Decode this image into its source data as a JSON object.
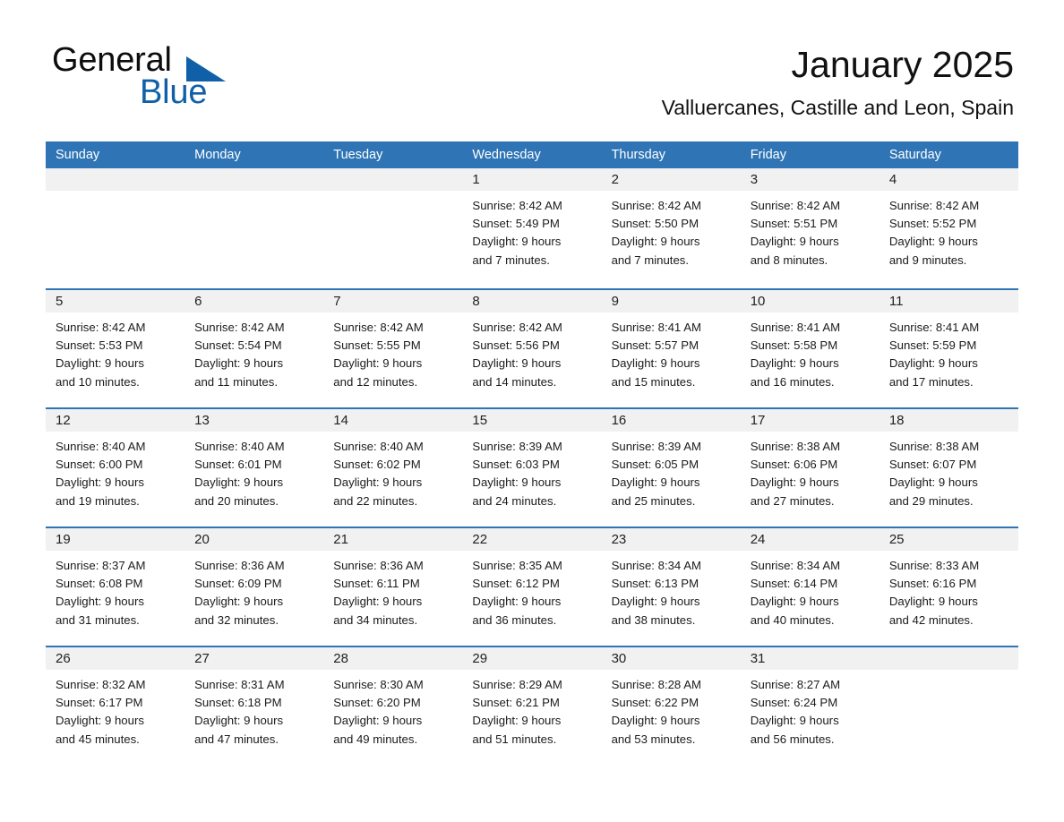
{
  "brand": {
    "word1": "General",
    "word2": "Blue",
    "flag_color": "#1060a8"
  },
  "header": {
    "month_title": "January 2025",
    "location": "Valluercanes, Castille and Leon, Spain"
  },
  "theme": {
    "header_blue": "#2f75b5",
    "row_divider_blue": "#2f75b5",
    "daynum_band": "#f1f1f1",
    "text": "#1b1b1b"
  },
  "weekdays": [
    "Sunday",
    "Monday",
    "Tuesday",
    "Wednesday",
    "Thursday",
    "Friday",
    "Saturday"
  ],
  "weeks": [
    [
      {
        "day": "",
        "lines": []
      },
      {
        "day": "",
        "lines": []
      },
      {
        "day": "",
        "lines": []
      },
      {
        "day": "1",
        "lines": [
          "Sunrise: 8:42 AM",
          "Sunset: 5:49 PM",
          "Daylight: 9 hours",
          "and 7 minutes."
        ]
      },
      {
        "day": "2",
        "lines": [
          "Sunrise: 8:42 AM",
          "Sunset: 5:50 PM",
          "Daylight: 9 hours",
          "and 7 minutes."
        ]
      },
      {
        "day": "3",
        "lines": [
          "Sunrise: 8:42 AM",
          "Sunset: 5:51 PM",
          "Daylight: 9 hours",
          "and 8 minutes."
        ]
      },
      {
        "day": "4",
        "lines": [
          "Sunrise: 8:42 AM",
          "Sunset: 5:52 PM",
          "Daylight: 9 hours",
          "and 9 minutes."
        ]
      }
    ],
    [
      {
        "day": "5",
        "lines": [
          "Sunrise: 8:42 AM",
          "Sunset: 5:53 PM",
          "Daylight: 9 hours",
          "and 10 minutes."
        ]
      },
      {
        "day": "6",
        "lines": [
          "Sunrise: 8:42 AM",
          "Sunset: 5:54 PM",
          "Daylight: 9 hours",
          "and 11 minutes."
        ]
      },
      {
        "day": "7",
        "lines": [
          "Sunrise: 8:42 AM",
          "Sunset: 5:55 PM",
          "Daylight: 9 hours",
          "and 12 minutes."
        ]
      },
      {
        "day": "8",
        "lines": [
          "Sunrise: 8:42 AM",
          "Sunset: 5:56 PM",
          "Daylight: 9 hours",
          "and 14 minutes."
        ]
      },
      {
        "day": "9",
        "lines": [
          "Sunrise: 8:41 AM",
          "Sunset: 5:57 PM",
          "Daylight: 9 hours",
          "and 15 minutes."
        ]
      },
      {
        "day": "10",
        "lines": [
          "Sunrise: 8:41 AM",
          "Sunset: 5:58 PM",
          "Daylight: 9 hours",
          "and 16 minutes."
        ]
      },
      {
        "day": "11",
        "lines": [
          "Sunrise: 8:41 AM",
          "Sunset: 5:59 PM",
          "Daylight: 9 hours",
          "and 17 minutes."
        ]
      }
    ],
    [
      {
        "day": "12",
        "lines": [
          "Sunrise: 8:40 AM",
          "Sunset: 6:00 PM",
          "Daylight: 9 hours",
          "and 19 minutes."
        ]
      },
      {
        "day": "13",
        "lines": [
          "Sunrise: 8:40 AM",
          "Sunset: 6:01 PM",
          "Daylight: 9 hours",
          "and 20 minutes."
        ]
      },
      {
        "day": "14",
        "lines": [
          "Sunrise: 8:40 AM",
          "Sunset: 6:02 PM",
          "Daylight: 9 hours",
          "and 22 minutes."
        ]
      },
      {
        "day": "15",
        "lines": [
          "Sunrise: 8:39 AM",
          "Sunset: 6:03 PM",
          "Daylight: 9 hours",
          "and 24 minutes."
        ]
      },
      {
        "day": "16",
        "lines": [
          "Sunrise: 8:39 AM",
          "Sunset: 6:05 PM",
          "Daylight: 9 hours",
          "and 25 minutes."
        ]
      },
      {
        "day": "17",
        "lines": [
          "Sunrise: 8:38 AM",
          "Sunset: 6:06 PM",
          "Daylight: 9 hours",
          "and 27 minutes."
        ]
      },
      {
        "day": "18",
        "lines": [
          "Sunrise: 8:38 AM",
          "Sunset: 6:07 PM",
          "Daylight: 9 hours",
          "and 29 minutes."
        ]
      }
    ],
    [
      {
        "day": "19",
        "lines": [
          "Sunrise: 8:37 AM",
          "Sunset: 6:08 PM",
          "Daylight: 9 hours",
          "and 31 minutes."
        ]
      },
      {
        "day": "20",
        "lines": [
          "Sunrise: 8:36 AM",
          "Sunset: 6:09 PM",
          "Daylight: 9 hours",
          "and 32 minutes."
        ]
      },
      {
        "day": "21",
        "lines": [
          "Sunrise: 8:36 AM",
          "Sunset: 6:11 PM",
          "Daylight: 9 hours",
          "and 34 minutes."
        ]
      },
      {
        "day": "22",
        "lines": [
          "Sunrise: 8:35 AM",
          "Sunset: 6:12 PM",
          "Daylight: 9 hours",
          "and 36 minutes."
        ]
      },
      {
        "day": "23",
        "lines": [
          "Sunrise: 8:34 AM",
          "Sunset: 6:13 PM",
          "Daylight: 9 hours",
          "and 38 minutes."
        ]
      },
      {
        "day": "24",
        "lines": [
          "Sunrise: 8:34 AM",
          "Sunset: 6:14 PM",
          "Daylight: 9 hours",
          "and 40 minutes."
        ]
      },
      {
        "day": "25",
        "lines": [
          "Sunrise: 8:33 AM",
          "Sunset: 6:16 PM",
          "Daylight: 9 hours",
          "and 42 minutes."
        ]
      }
    ],
    [
      {
        "day": "26",
        "lines": [
          "Sunrise: 8:32 AM",
          "Sunset: 6:17 PM",
          "Daylight: 9 hours",
          "and 45 minutes."
        ]
      },
      {
        "day": "27",
        "lines": [
          "Sunrise: 8:31 AM",
          "Sunset: 6:18 PM",
          "Daylight: 9 hours",
          "and 47 minutes."
        ]
      },
      {
        "day": "28",
        "lines": [
          "Sunrise: 8:30 AM",
          "Sunset: 6:20 PM",
          "Daylight: 9 hours",
          "and 49 minutes."
        ]
      },
      {
        "day": "29",
        "lines": [
          "Sunrise: 8:29 AM",
          "Sunset: 6:21 PM",
          "Daylight: 9 hours",
          "and 51 minutes."
        ]
      },
      {
        "day": "30",
        "lines": [
          "Sunrise: 8:28 AM",
          "Sunset: 6:22 PM",
          "Daylight: 9 hours",
          "and 53 minutes."
        ]
      },
      {
        "day": "31",
        "lines": [
          "Sunrise: 8:27 AM",
          "Sunset: 6:24 PM",
          "Daylight: 9 hours",
          "and 56 minutes."
        ]
      },
      {
        "day": "",
        "lines": []
      }
    ]
  ]
}
